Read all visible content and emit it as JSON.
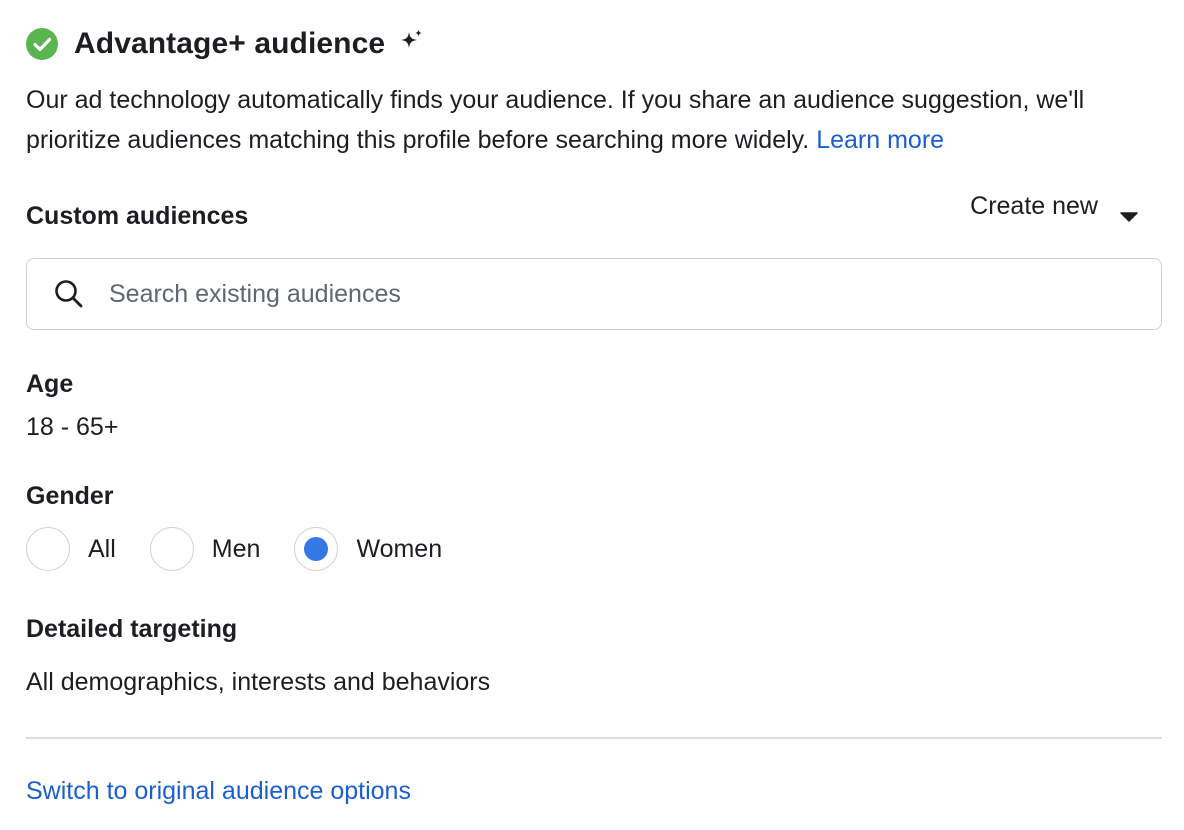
{
  "header": {
    "title": "Advantage+ audience",
    "check_icon": "check-circle-icon",
    "sparkle_icon": "sparkle-icon",
    "check_color": "#5ab550"
  },
  "description": {
    "text": "Our ad technology automatically finds your audience. If you share an audience suggestion, we'll prioritize audiences matching this profile before searching more widely. ",
    "learn_more": "Learn more"
  },
  "custom_audiences": {
    "label": "Custom audiences",
    "create_new": "Create new",
    "search_placeholder": "Search existing audiences"
  },
  "age": {
    "label": "Age",
    "value": "18 - 65+"
  },
  "gender": {
    "label": "Gender",
    "options": [
      {
        "label": "All",
        "selected": false
      },
      {
        "label": "Men",
        "selected": false
      },
      {
        "label": "Women",
        "selected": true
      }
    ]
  },
  "detailed_targeting": {
    "label": "Detailed targeting",
    "value": "All demographics, interests and behaviors"
  },
  "footer": {
    "switch_link": "Switch to original audience options"
  },
  "colors": {
    "link": "#1a5fd0",
    "radio_selected": "#3578e5",
    "border": "#ced0d4"
  }
}
